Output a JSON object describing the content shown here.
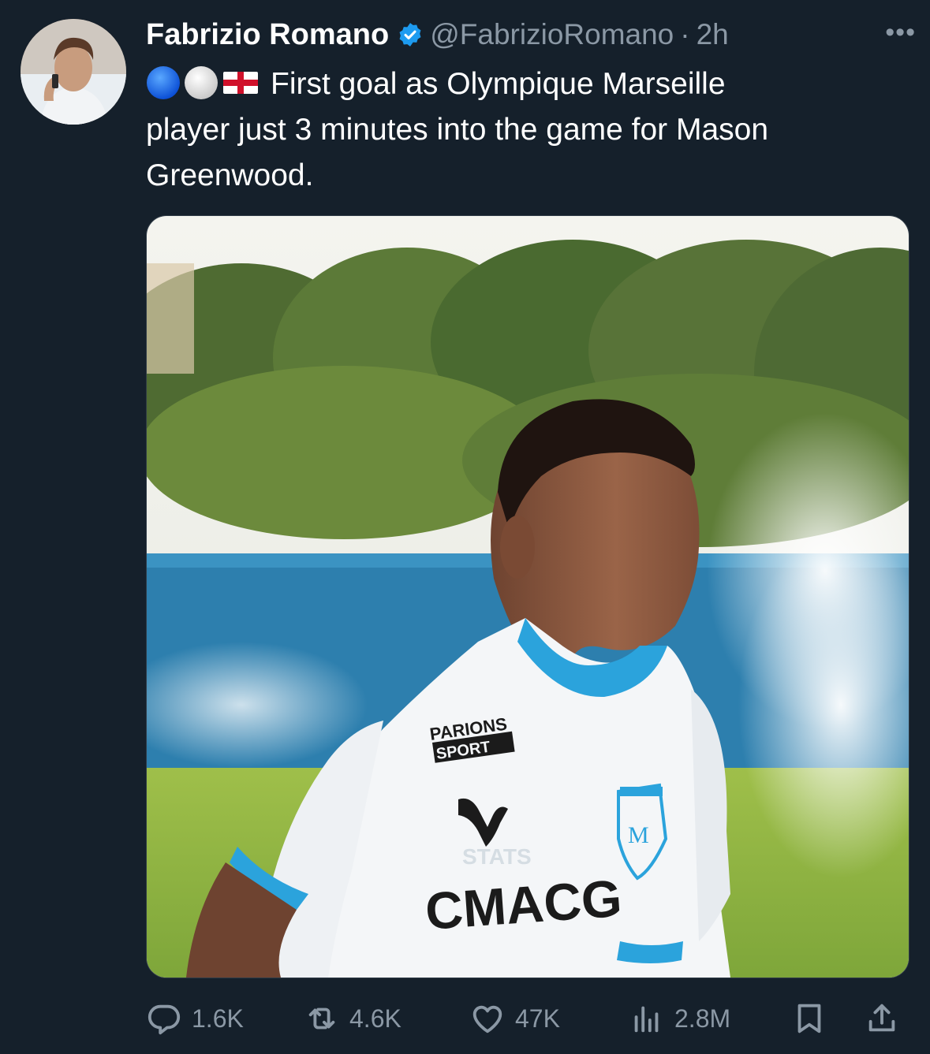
{
  "author": {
    "name": "Fabrizio Romano",
    "handle": "@FabrizioRomano",
    "separator": "·",
    "time": "2h",
    "verified": true
  },
  "tweet": {
    "emojis": [
      "blue-circle",
      "white-circle",
      "england-flag"
    ],
    "text_line1": "First goal as Olympique Marseille",
    "text_line2": "player just 3 minutes into the game for Mason",
    "text_line3": "Greenwood."
  },
  "media": {
    "shirt_sponsor_top": "PARIONS",
    "shirt_sponsor_bottom": "SPORT",
    "shirt_main_sponsor": "CMACG",
    "shirt_stats": "STATS"
  },
  "actions": {
    "replies": "1.6K",
    "retweets": "4.6K",
    "likes": "47K",
    "views": "2.8M"
  },
  "colors": {
    "background": "#15202b",
    "text_secondary": "#8b98a5",
    "verified_blue": "#1d9bf0",
    "om_blue": "#2ba3dc"
  },
  "icons": [
    "more-icon",
    "verified-icon",
    "reply-icon",
    "retweet-icon",
    "like-icon",
    "views-icon",
    "bookmark-icon",
    "share-icon"
  ]
}
